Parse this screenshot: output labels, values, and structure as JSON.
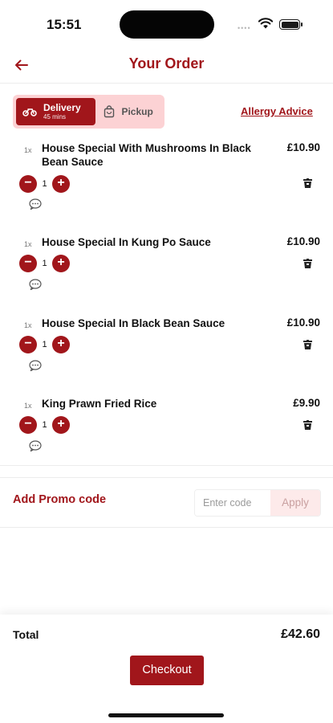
{
  "status_bar": {
    "time": "15:51"
  },
  "header": {
    "title": "Your Order",
    "back_icon": "arrow-left-icon"
  },
  "order_mode": {
    "options": [
      {
        "label": "Delivery",
        "sub": "45 mins",
        "icon": "motorbike-icon",
        "active": true
      },
      {
        "label": "Pickup",
        "icon": "shopping-bag-icon",
        "active": false
      }
    ]
  },
  "allergy": {
    "label": "Allergy Advice"
  },
  "items": [
    {
      "qty_prefix": "1x",
      "name": "House Special With Mushrooms In Black Bean Sauce",
      "price": "£10.90",
      "quantity": "1"
    },
    {
      "qty_prefix": "1x",
      "name": "House Special In Kung Po Sauce",
      "price": "£10.90",
      "quantity": "1"
    },
    {
      "qty_prefix": "1x",
      "name": "House Special In Black Bean Sauce",
      "price": "£10.90",
      "quantity": "1"
    },
    {
      "qty_prefix": "1x",
      "name": "King Prawn Fried Rice",
      "price": "£9.90",
      "quantity": "1"
    }
  ],
  "promo": {
    "label": "Add Promo code",
    "placeholder": "Enter code",
    "value": "",
    "apply_label": "Apply"
  },
  "footer": {
    "total_label": "Total",
    "total_value": "£42.60",
    "checkout_label": "Checkout"
  },
  "colors": {
    "accent": "#a1161b",
    "accent_light": "#fcd2d4",
    "apply_bg": "#fdeaea"
  }
}
